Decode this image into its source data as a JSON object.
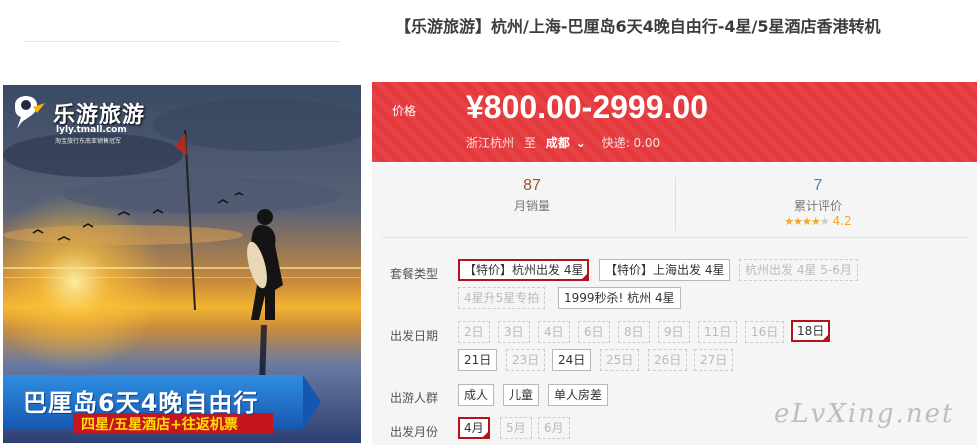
{
  "image": {
    "logo_name": "乐游旅游",
    "logo_url": "lyly.tmall.com",
    "logo_sub": "淘宝旅行东南亚销售冠军",
    "banner_title": "巴厘岛6天4晚自由行",
    "banner_sub": "四星/五星酒店+往返机票"
  },
  "product": {
    "title": "【乐游旅游】杭州/上海-巴厘岛6天4晚自由行-4星/5星酒店香港转机"
  },
  "price": {
    "label": "价格",
    "value": "¥800.00-2999.00",
    "origin": "浙江杭州",
    "to": "至",
    "destination": "成都",
    "shipping": "快递: 0.00"
  },
  "stats": {
    "sales_value": "87",
    "sales_label": "月销量",
    "reviews_value": "7",
    "reviews_label": "累计评价",
    "rating": "4.2"
  },
  "options": {
    "package": {
      "label": "套餐类型",
      "items": [
        "【特价】杭州出发 4星",
        "【特价】上海出发 4星",
        "杭州出发 4星 5-6月",
        "4星升5星专拍",
        "1999秒杀! 杭州 4星"
      ]
    },
    "date": {
      "label": "出发日期",
      "items": [
        "2日",
        "3日",
        "4日",
        "6日",
        "8日",
        "9日",
        "11日",
        "16日",
        "18日",
        "21日",
        "23日",
        "24日",
        "25日",
        "26日",
        "27日"
      ]
    },
    "people": {
      "label": "出游人群",
      "items": [
        "成人",
        "儿童",
        "单人房差"
      ]
    },
    "month": {
      "label": "出发月份",
      "items": [
        "4月",
        "5月",
        "6月"
      ]
    }
  },
  "watermark": "eLvXing.net",
  "colors": {
    "price_bg": "#e4393c",
    "selected_border": "#b4131a",
    "star": "#f6a623"
  }
}
